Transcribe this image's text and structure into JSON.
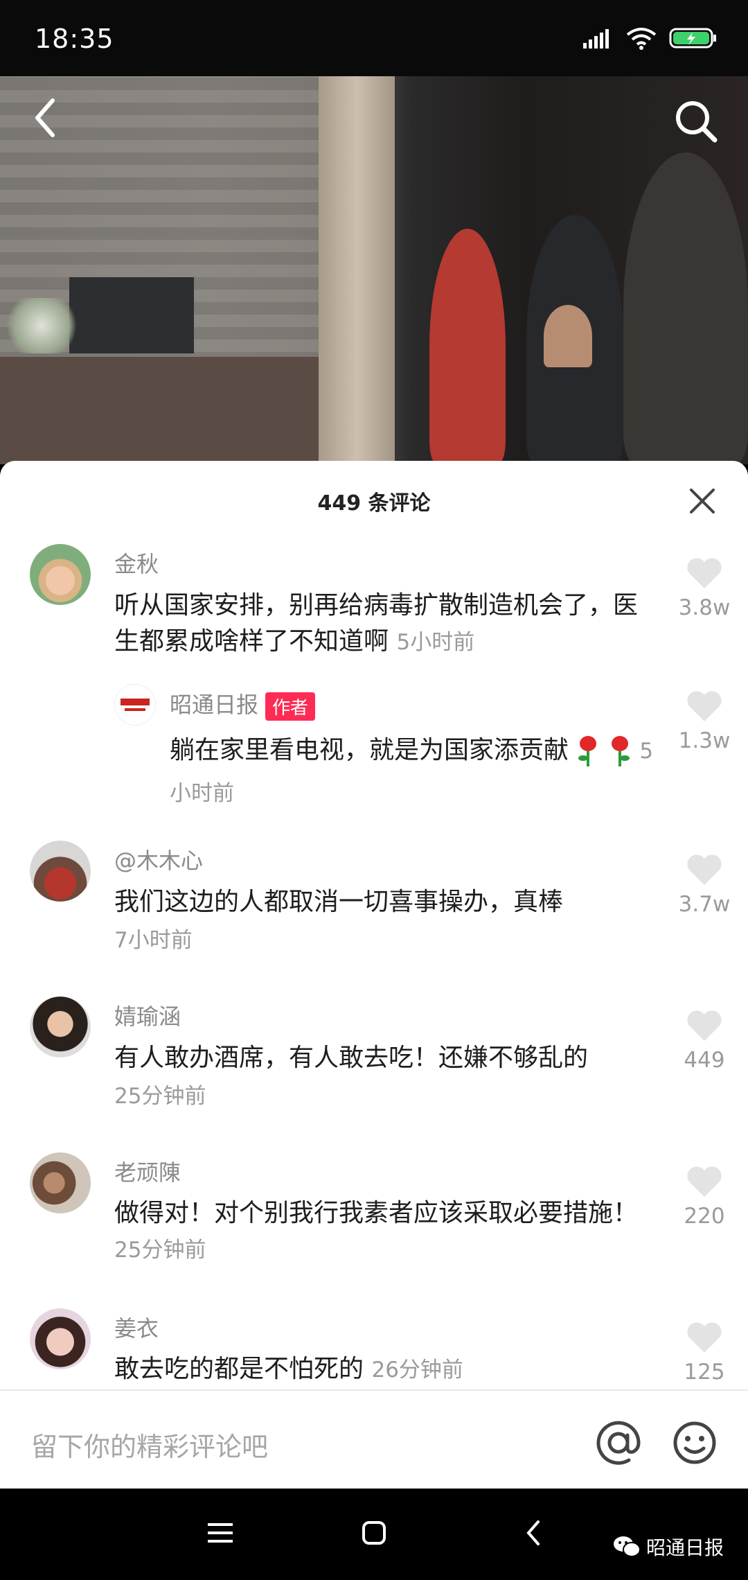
{
  "status_bar": {
    "time": "18:35"
  },
  "sheet": {
    "title": "449 条评论"
  },
  "comments": [
    {
      "name": "金秋",
      "text": "听从国家安排，别再给病毒扩散制造机会了，医生都累成啥样了不知道啊",
      "time": "5小时前",
      "likes": "3.8w"
    },
    {
      "name": "昭通日报",
      "badge": "作者",
      "text": "躺在家里看电视，就是为国家添贡献",
      "time": "5小时前",
      "likes": "1.3w"
    },
    {
      "name": "@木木心",
      "text": "我们这边的人都取消一切喜事操办，真棒",
      "time": "7小时前",
      "likes": "3.7w"
    },
    {
      "name": "婧瑜涵",
      "text": "有人敢办酒席，有人敢去吃！还嫌不够乱的",
      "time": "25分钟前",
      "likes": "449"
    },
    {
      "name": "老顽陳",
      "text": "做得对！对个别我行我素者应该采取必要措施！",
      "time": "25分钟前",
      "likes": "220"
    },
    {
      "name": "姜衣",
      "text": "敢去吃的都是不怕死的",
      "time": "26分钟前",
      "likes": "125"
    }
  ],
  "input": {
    "placeholder": "留下你的精彩评论吧"
  },
  "watermark": {
    "text": "昭通日报"
  },
  "colors": {
    "accent": "#fe2c55",
    "muted": "#9a9a9a",
    "heart": "#e3e3e3"
  }
}
